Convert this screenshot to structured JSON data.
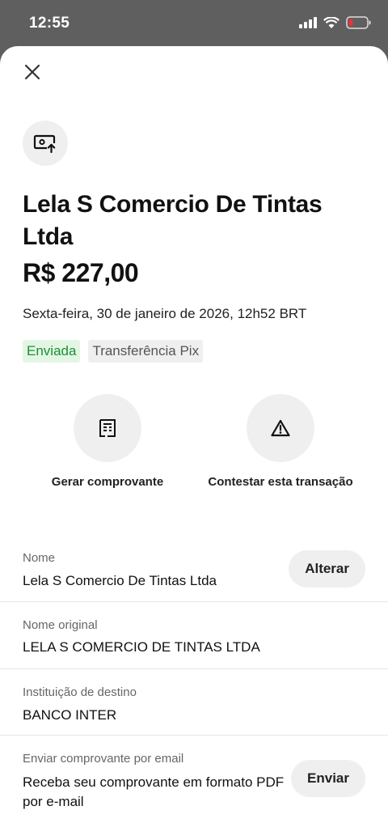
{
  "status_bar": {
    "time": "12:55"
  },
  "header": {
    "close_icon": "close-icon"
  },
  "transaction": {
    "icon": "transfer-out-icon",
    "recipient": "Lela S Comercio De Tintas Ltda",
    "amount": "R$ 227,00",
    "date": "Sexta-feira, 30 de janeiro de 2026, 12h52 BRT",
    "status_tag": "Enviada",
    "type_tag": "Transferência Pix"
  },
  "actions": [
    {
      "label": "Gerar comprovante",
      "icon": "receipt-icon"
    },
    {
      "label": "Contestar esta transação",
      "icon": "warning-icon"
    }
  ],
  "details": {
    "name": {
      "label": "Nome",
      "value": "Lela S Comercio De Tintas Ltda",
      "button": "Alterar"
    },
    "original_name": {
      "label": "Nome original",
      "value": "LELA S COMERCIO DE TINTAS LTDA"
    },
    "institution": {
      "label": "Instituição de destino",
      "value": "BANCO INTER"
    },
    "email_receipt": {
      "label": "Enviar comprovante por email",
      "value": "Receba seu comprovante em formato PDF por e-mail",
      "button": "Enviar"
    }
  },
  "colors": {
    "sent_green": "#1b8f34",
    "sent_bg": "#e3f6e4",
    "chip_bg": "#efefef"
  }
}
